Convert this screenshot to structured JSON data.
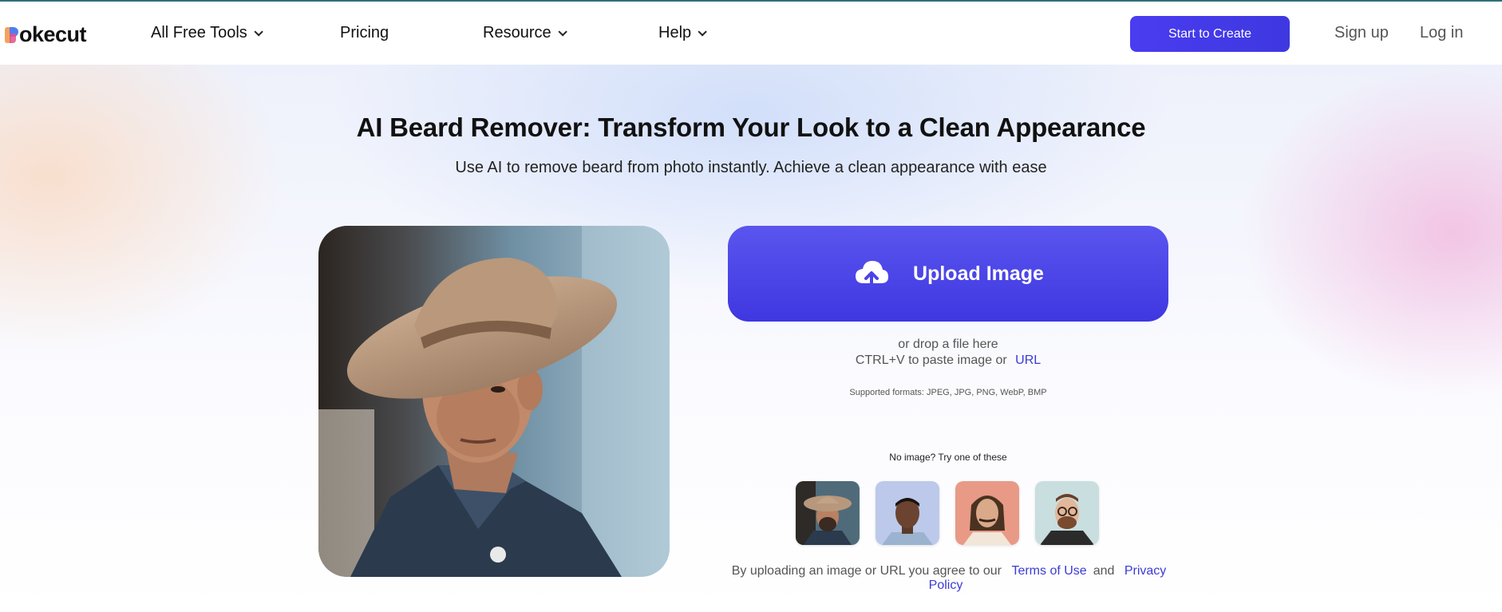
{
  "brand": {
    "logo_text": "okecut"
  },
  "nav": {
    "all_free_tools": "All Free Tools",
    "pricing": "Pricing",
    "resource": "Resource",
    "help": "Help",
    "start_to_create": "Start to Create",
    "sign_up": "Sign up",
    "log_in": "Log in"
  },
  "hero": {
    "title": "AI Beard Remover: Transform Your Look to a Clean Appearance",
    "subtitle": "Use AI to remove beard from photo instantly. Achieve a clean appearance with ease"
  },
  "upload": {
    "button_label": "Upload Image",
    "drop_text": "or drop a file here",
    "paste_text": "CTRL+V to paste image or",
    "url_label": "URL",
    "formats": "Supported formats: JPEG, JPG, PNG, WebP, BMP",
    "try_label": "No image? Try one of these"
  },
  "terms": {
    "prefix": "By uploading an image or URL you agree to our",
    "terms_label": "Terms of Use",
    "and": "and",
    "privacy_label": "Privacy Policy"
  },
  "colors": {
    "accent": "#4a3cf0",
    "link": "#3b3bd4"
  },
  "icons": [
    "chevron-down-icon",
    "cloud-upload-icon"
  ]
}
